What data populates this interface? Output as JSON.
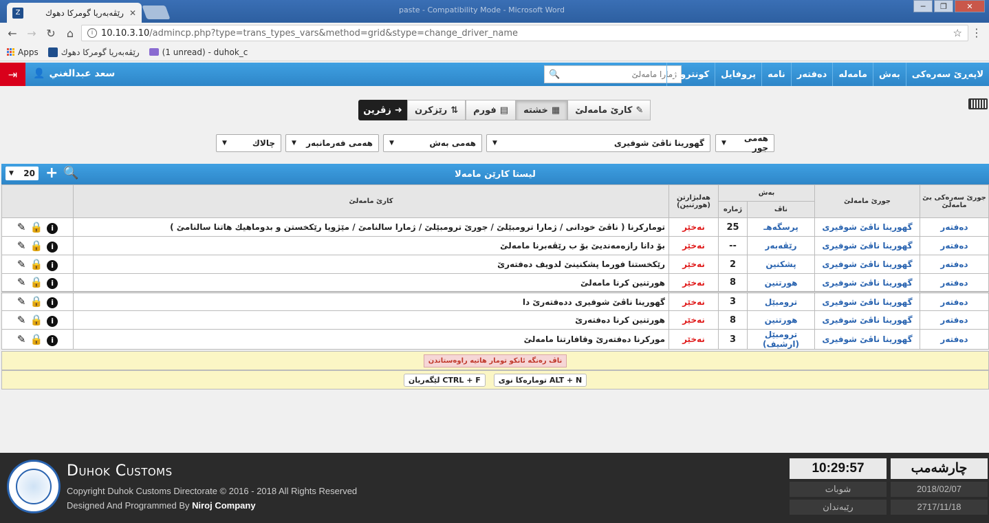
{
  "browser": {
    "tab_title": "رێڤەبەریا گومرکا دهوك",
    "window_caption": "paste - Compatibility Mode - Microsoft Word",
    "url_host": "10.10.3.10",
    "url_rest": "/admincp.php?type=trans_types_vars&method=grid&stype=change_driver_name",
    "bookmarks": {
      "apps": "Apps",
      "site": "رێڤەبەریا گومرکا دهوك",
      "mail": "(1 unread) - duhok_c"
    }
  },
  "appnav": {
    "user_name": "سعد عبدالغني",
    "menu": [
      "لاپەڕێ سەرەكی",
      "بەش",
      "مامەلە",
      "دەفتەر",
      "نامە",
      "پروفايل",
      "كونترول"
    ],
    "search_placeholder": "ژمارا مامەلێ"
  },
  "toolbar": {
    "btn_task": "كارێ مامەلێ",
    "btn_grid": "خشتە",
    "btn_form": "فورم",
    "btn_sort": "رێزكرن",
    "btn_back": "زڤرین"
  },
  "filters": {
    "type": "هەمی جور",
    "driver": "گهورینا ناڤێ شوفیری",
    "section": "هەمی بەش",
    "employee": "هەمی فەرمانبەر",
    "status": "چالاك"
  },
  "list": {
    "title": "ليستا كارێن مامەلا",
    "page_size": "20"
  },
  "table": {
    "headers": {
      "main_type": "جورێ سەرەكی بێ مامەلێ",
      "type": "جورێ مامەلێ",
      "section": "بەش",
      "name": "ناڤ",
      "number": "ژمارە",
      "required": "هەلبژارتن (هورتنین)",
      "task": "كارێ مامەلێ"
    },
    "rows": [
      {
        "main_type": "دەفتەر",
        "type": "گهورینا ناڤێ شوفیری",
        "section": "پرسگەهـ",
        "number": "25",
        "required": "نەخێر",
        "task": "تومارکرنا ( ناڤێ خودانی / ژمارا ترومبێلێ / جورێ ترومبێلێ / ژمارا سالنامێ / مێژویا رێكخستن و بدوماهیك هاتنا سالنامێ )"
      },
      {
        "main_type": "دەفتەر",
        "type": "گهورینا ناڤێ شوفیری",
        "section": "رێڤەبەر",
        "number": "--",
        "required": "نەخێر",
        "task": "بۆ دانا رازەمەندیێ بۆ ب رێڤەبرنا مامەلێ"
      },
      {
        "main_type": "دەفتەر",
        "type": "گهورینا ناڤێ شوفیری",
        "section": "پشكنین",
        "number": "2",
        "required": "نەخێر",
        "task": "رێكخستنا فورما پشكنینێ لدویف دەفتەرێ"
      },
      {
        "main_type": "دەفتەر",
        "type": "گهورینا ناڤێ شوفیری",
        "section": "هورتنین",
        "number": "8",
        "required": "نەخێر",
        "task": "هورتنین كرنا مامەلێ"
      },
      {
        "main_type": "دەفتەر",
        "type": "گهورینا ناڤێ شوفیری",
        "section": "ترومبێل",
        "number": "3",
        "required": "نەخێر",
        "task": "گهورینا ناڤێ شوفیری ددەفتەرێ دا"
      },
      {
        "main_type": "دەفتەر",
        "type": "گهورینا ناڤێ شوفیری",
        "section": "هورتنین",
        "number": "8",
        "required": "نەخێر",
        "task": "هورتنین كرنا دەفتەرێ"
      },
      {
        "main_type": "دەفتەر",
        "type": "گهورینا ناڤێ شوفیری",
        "section": "ترومبێل (ارشیف)",
        "number": "3",
        "required": "نەخێر",
        "task": "موركرنا دەفتەرێ وقافارتنا مامەلێ"
      }
    ]
  },
  "notes": {
    "red_note": "ناڤ رەنگە ئانكو تومار هاتیە راوەستاندن",
    "hint_new_key": "ALT + N",
    "hint_new_label": "تومارەكا نوی",
    "hint_search_key": "CTRL + F",
    "hint_search_label": "لێگەریان"
  },
  "footer": {
    "brand": "Duhok Customs",
    "copyright": "Copyright Duhok Customs Directorate © 2016 - 2018 All Rights Reserved",
    "designed_prefix": "Designed And Programmed By",
    "designed_company": "Niroj Company",
    "day": "چارشەمب",
    "time": "10:29:57",
    "date1": "2018/02/07",
    "month1": "شوبات",
    "date2": "2717/11/18",
    "month2": "رێبەندان"
  },
  "icons": {
    "logout": "logout-icon",
    "user": "user-icon",
    "keyboard": "keyboard-icon"
  }
}
